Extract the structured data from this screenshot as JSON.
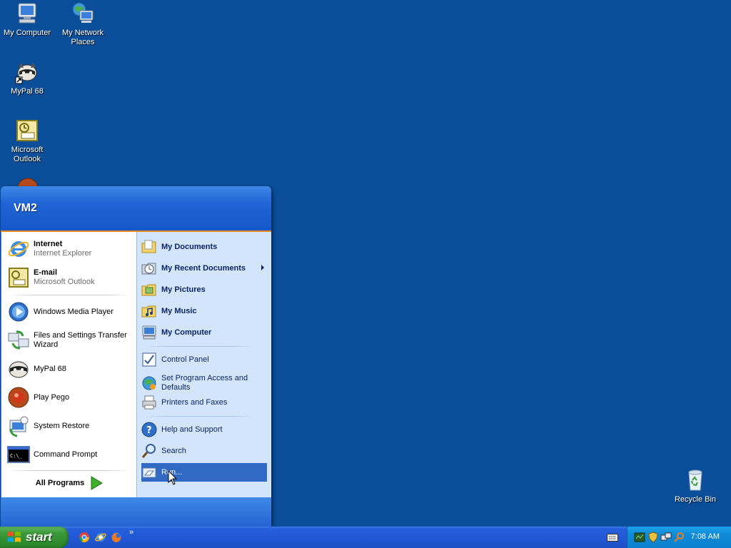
{
  "desktop": {
    "icons": [
      {
        "label": "My Computer",
        "icon": "my-computer-icon"
      },
      {
        "label": "My Network Places",
        "icon": "network-places-icon"
      },
      {
        "label": "MyPal 68",
        "icon": "mypal-icon"
      },
      {
        "label": "Microsoft Outlook",
        "icon": "outlook-icon"
      },
      {
        "label": "Recycle Bin",
        "icon": "recycle-bin-icon"
      }
    ]
  },
  "start_menu": {
    "user": "VM2",
    "pinned": [
      {
        "title": "Internet",
        "subtitle": "Internet Explorer",
        "icon": "internet-explorer-icon"
      },
      {
        "title": "E-mail",
        "subtitle": "Microsoft Outlook",
        "icon": "outlook-icon"
      }
    ],
    "recent": [
      {
        "label": "Windows Media Player",
        "icon": "media-player-icon"
      },
      {
        "label": "Files and Settings Transfer Wizard",
        "icon": "transfer-wizard-icon"
      },
      {
        "label": "MyPal 68",
        "icon": "mypal-icon"
      },
      {
        "label": "Play Pego",
        "icon": "pego-icon"
      },
      {
        "label": "System Restore",
        "icon": "system-restore-icon"
      },
      {
        "label": "Command Prompt",
        "icon": "command-prompt-icon"
      }
    ],
    "all_programs": "All Programs",
    "places": [
      {
        "label": "My Documents",
        "icon": "folder-icon"
      },
      {
        "label": "My Recent Documents",
        "icon": "recent-documents-icon"
      },
      {
        "label": "My Pictures",
        "icon": "pictures-folder-icon"
      },
      {
        "label": "My Music",
        "icon": "music-folder-icon"
      },
      {
        "label": "My Computer",
        "icon": "my-computer-icon"
      }
    ],
    "settings": [
      {
        "label": "Control Panel",
        "icon": "control-panel-icon"
      },
      {
        "label": "Set Program Access and Defaults",
        "icon": "program-access-icon"
      },
      {
        "label": "Printers and Faxes",
        "icon": "printer-icon"
      }
    ],
    "help": [
      {
        "label": "Help and Support",
        "icon": "help-icon"
      },
      {
        "label": "Search",
        "icon": "search-icon"
      },
      {
        "label": "Run...",
        "icon": "run-icon",
        "highlighted": true
      }
    ]
  },
  "taskbar": {
    "start_label": "start",
    "quick_launch": [
      "chrome-icon",
      "internet-explorer-icon",
      "firefox-icon"
    ],
    "quick_launch_more": "»",
    "clock": "7:08 AM"
  },
  "colors": {
    "desktop": "#0a4d99",
    "start_green": "#3c9a3c",
    "menu_blue": "#1f63d4",
    "highlight": "#316ac5",
    "accent_orange": "#e88a23"
  }
}
